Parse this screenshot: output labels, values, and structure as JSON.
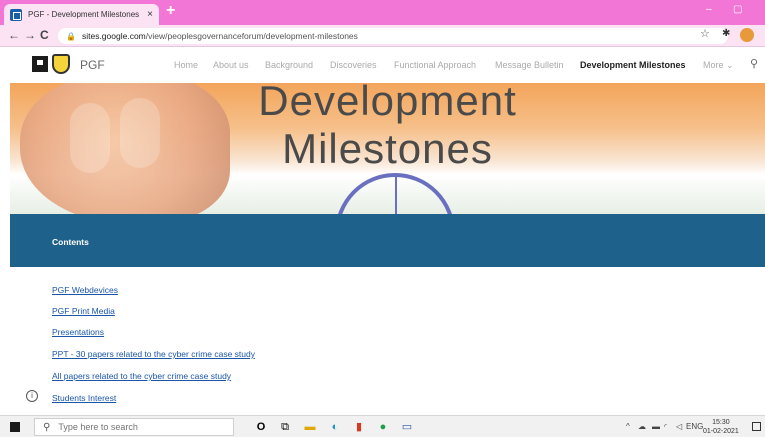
{
  "browser": {
    "tab_title": "PGF - Development Milestones",
    "tab_close": "×",
    "new_tab": "+",
    "url_host": "sites.google.com",
    "url_path": "/view/peoplesgovernanceforum/development-milestones",
    "back": "←",
    "forward": "→",
    "reload": "C",
    "minimize": "–",
    "maximize": "▢"
  },
  "site": {
    "name": "PGF",
    "nav": [
      {
        "label": "Home"
      },
      {
        "label": "About us"
      },
      {
        "label": "Background"
      },
      {
        "label": "Discoveries"
      },
      {
        "label": "Functional Approach"
      },
      {
        "label": "Message Bulletin"
      },
      {
        "label": "Development Milestones"
      },
      {
        "label": "More ⌄"
      }
    ],
    "hero_title_line1": "Development",
    "hero_title_line2": "Milestones",
    "contents_label": "Contents",
    "links": [
      {
        "label": "PGF Webdevices"
      },
      {
        "label": "PGF Print Media"
      },
      {
        "label": "Presentations"
      },
      {
        "label": "PPT - 30 papers related to the cyber crime case study"
      },
      {
        "label": "All papers related to the cyber crime case study"
      },
      {
        "label": "Students Interest"
      }
    ]
  },
  "taskbar": {
    "search_placeholder": "Type here to search",
    "language": "ENG",
    "time": "15:30",
    "date": "01-02-2021"
  },
  "colors": {
    "tabbar": "#f276d6",
    "contents_band": "#1e628c",
    "link": "#1a56a8"
  }
}
